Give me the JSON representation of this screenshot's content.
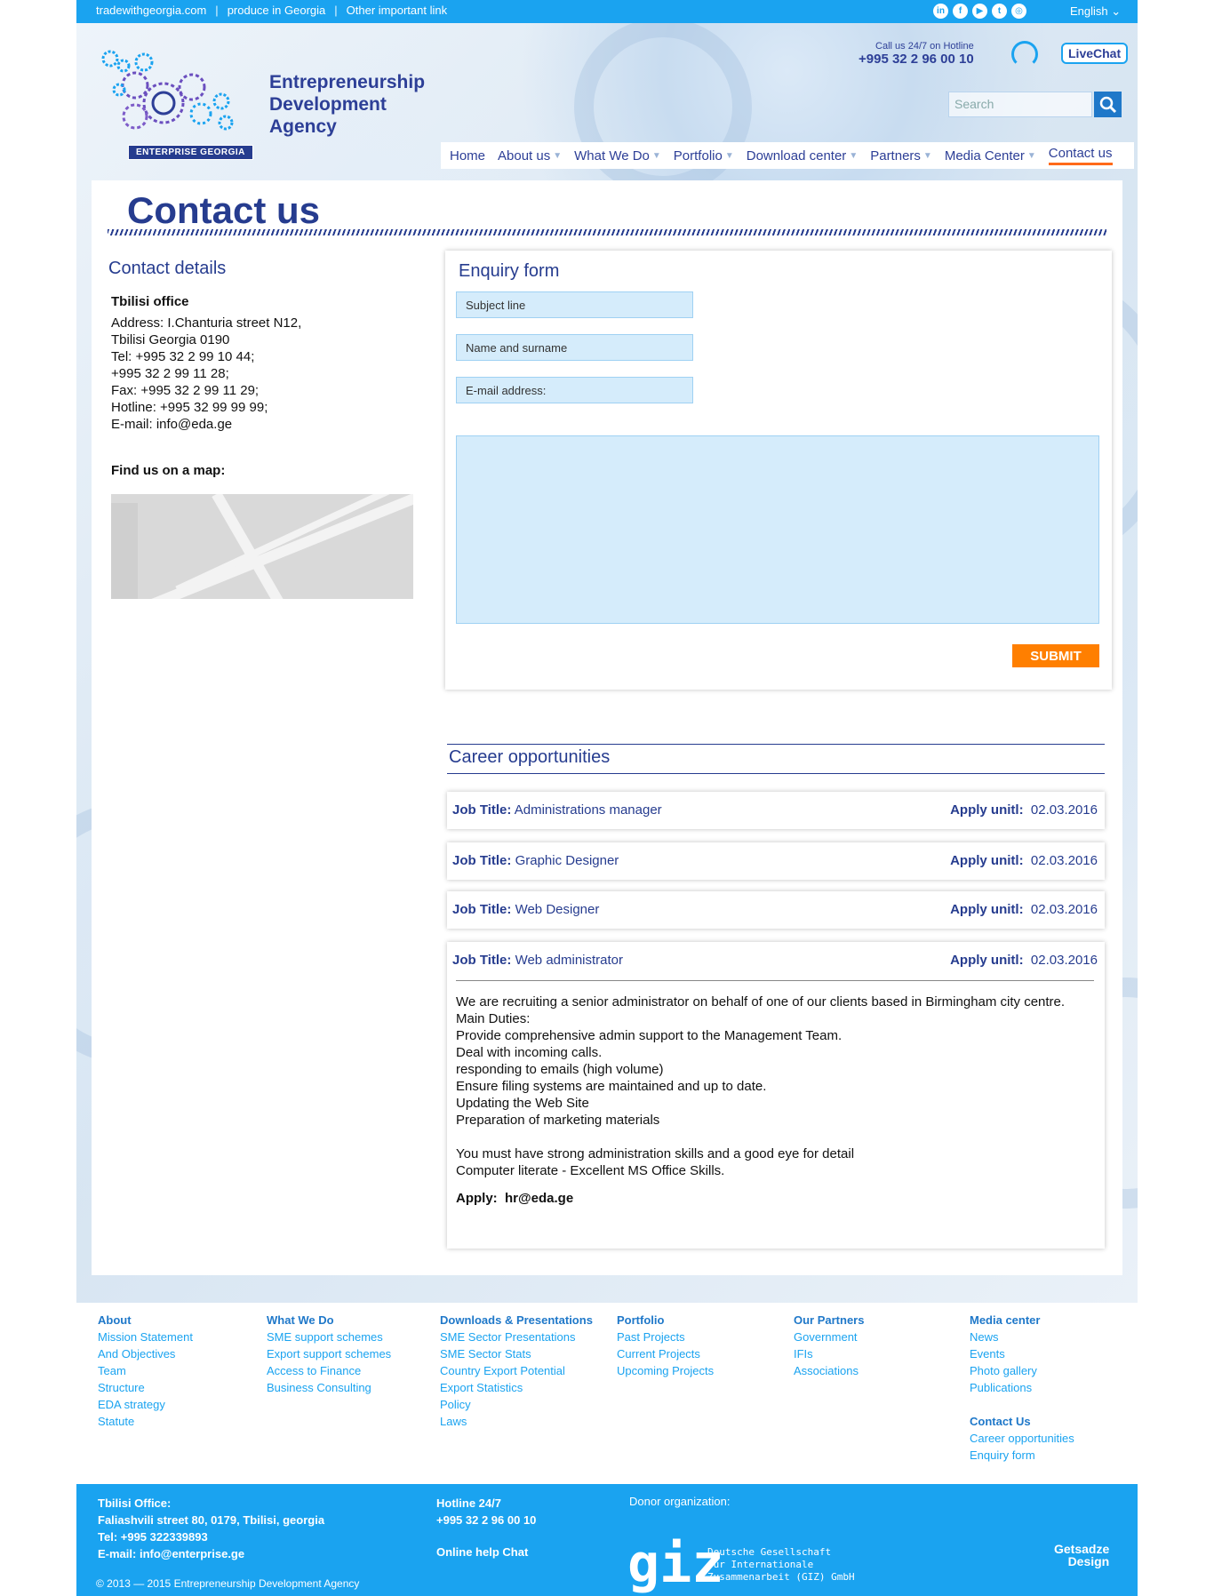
{
  "topbar": {
    "link1": "tradewithgeorgia.com",
    "sep": "|",
    "link2": "produce in Georgia",
    "link3": "Other important link",
    "language": "English",
    "social": [
      "in",
      "f",
      "▶",
      "t",
      "◎"
    ]
  },
  "brand": {
    "line1": "Entrepreneurship",
    "line2": "Development",
    "line3": "Agency",
    "badge": "ENTERPRISE GEORGIA"
  },
  "hotline": {
    "label": "Call us 24/7 on Hotline",
    "number": "+995 32 2 96  00 10"
  },
  "livechat": "LiveChat",
  "search": {
    "placeholder": "Search"
  },
  "nav": [
    "Home",
    "About us",
    "What We Do",
    "Portfolio",
    "Download center",
    "Partners",
    "Media Center",
    "Contact us"
  ],
  "page_title": "Contact us",
  "contact": {
    "title": "Contact details",
    "office": "Tbilisi office",
    "lines": [
      "Address: I.Chanturia street N12,",
      "Tbilisi Georgia 0190",
      "Tel: +995 32 2 99 10 44;",
      "+995 32 2 99 11 28;",
      "Fax: +995 32 2 99 11 29;",
      "Hotline: +995 32 99 99 99;",
      "E-mail: info@eda.ge"
    ],
    "map_label": "Find us on a map:"
  },
  "form": {
    "title": "Enquiry form",
    "subject": "Subject line",
    "name": "Name and surname",
    "email": "E-mail address:",
    "submit": "SUBMIT"
  },
  "careers": {
    "title": "Career opportunities",
    "job_label": "Job Title:",
    "apply_label": "Apply unitl:",
    "jobs": [
      {
        "title": "Administrations manager",
        "date": "02.03.2016"
      },
      {
        "title": "Graphic Designer",
        "date": "02.03.2016"
      },
      {
        "title": "Web Designer",
        "date": "02.03.2016"
      },
      {
        "title": "Web administrator",
        "date": "02.03.2016"
      }
    ],
    "desc": [
      "We are recruiting a senior administrator on behalf of one of our clients based in Birmingham city centre.",
      "Main Duties:",
      "Provide comprehensive admin support to the Management Team.",
      "Deal with incoming calls.",
      "responding to emails (high volume)",
      "Ensure filing systems are maintained and up to date.",
      "Updating the Web Site",
      "Preparation of marketing materials",
      "",
      "You must have strong administration skills and a good eye for detail",
      "Computer literate - Excellent MS Office Skills."
    ],
    "apply": "Apply:",
    "apply_email": "hr@eda.ge"
  },
  "footer": {
    "about": {
      "h": "About",
      "items": [
        "Mission Statement",
        "And Objectives",
        "Team",
        "Structure",
        "EDA strategy",
        "Statute"
      ]
    },
    "whatwedo": {
      "h": "What We Do",
      "items": [
        "SME support schemes",
        "Export support schemes",
        "Access to Finance",
        "Business Consulting"
      ]
    },
    "downloads": {
      "h": "Downloads & Presentations",
      "items": [
        "SME Sector Presentations",
        "SME Sector Stats",
        "Country Export Potential",
        "Export Statistics",
        "Policy",
        "Laws"
      ]
    },
    "portfolio": {
      "h": "Portfolio",
      "items": [
        "Past Projects",
        "Current Projects",
        "Upcoming Projects"
      ]
    },
    "partners": {
      "h": "Our Partners",
      "items": [
        "Government",
        "IFIs",
        "Associations"
      ]
    },
    "media": {
      "h": "Media center",
      "items": [
        "News",
        "Events",
        "Photo gallery",
        "Publications"
      ]
    },
    "contact": {
      "h": "Contact Us",
      "items": [
        "Career opportunities",
        "Enquiry form"
      ]
    }
  },
  "bottom": {
    "office_h": "Tbilisi Office:",
    "address": "Faliashvili street 80, 0179, Tbilisi, georgia",
    "tel": "Tel: +995 322339893",
    "email": "E-mail: info@enterprise.ge",
    "hotline_h": "Hotline 24/7",
    "hotline": "+995 32 2 96 00 10",
    "chat": "Online help Chat",
    "donor": "Donor organization:",
    "giz": "giz",
    "giz1": "Deutsche Gesellschaft",
    "giz2": "für Internationale",
    "giz3": "Zusammenarbeit (GIZ) GmbH",
    "design1": "Getsadze",
    "design2": "Design",
    "copyright": "© 2013 — 2015 Entrepreneurship Development Agency"
  }
}
